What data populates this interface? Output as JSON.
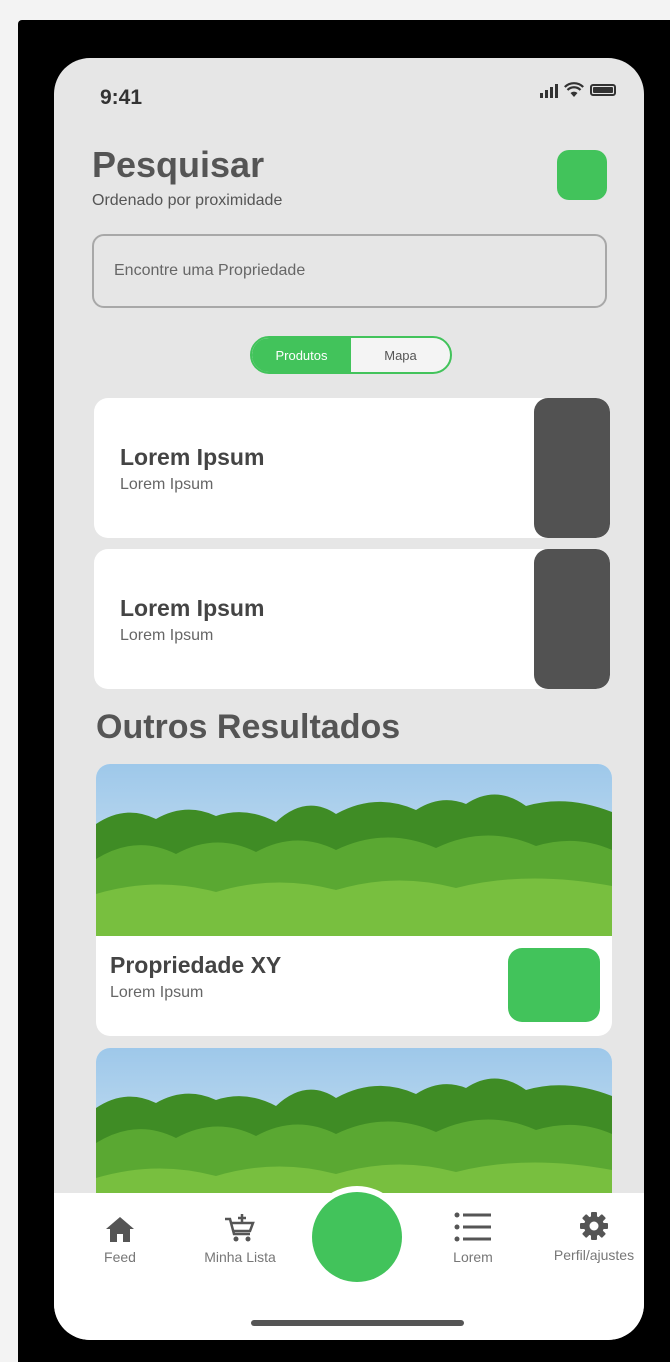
{
  "status": {
    "time": "9:41"
  },
  "header": {
    "title": "Pesquisar",
    "subtitle": "Ordenado por proximidade"
  },
  "search": {
    "placeholder": "Encontre uma Propriedade"
  },
  "segmented": {
    "options": [
      {
        "label": "Produtos",
        "active": true
      },
      {
        "label": "Mapa",
        "active": false
      }
    ]
  },
  "cards": [
    {
      "title": "Lorem Ipsum",
      "subtitle": "Lorem Ipsum"
    },
    {
      "title": "Lorem Ipsum",
      "subtitle": "Lorem Ipsum"
    }
  ],
  "section": {
    "title": "Outros Resultados"
  },
  "results": [
    {
      "title": "Propriedade XY",
      "subtitle": "Lorem Ipsum"
    },
    {
      "title": "",
      "subtitle": ""
    }
  ],
  "tabbar": {
    "items": [
      {
        "label": "Feed",
        "icon": "home-icon"
      },
      {
        "label": "Minha Lista",
        "icon": "cart-add-icon"
      },
      {
        "label": "Lorem",
        "icon": "list-icon"
      },
      {
        "label": "Perfil/ajustes",
        "icon": "gear-icon"
      }
    ]
  },
  "colors": {
    "accent": "#42c35b",
    "dark": "#525252"
  }
}
